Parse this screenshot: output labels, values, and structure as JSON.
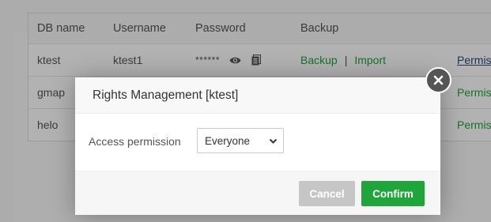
{
  "table": {
    "headers": {
      "db_name": "DB name",
      "username": "Username",
      "password": "Password",
      "backup": "Backup"
    },
    "rows": [
      {
        "db_name": "ktest",
        "username": "ktest1",
        "password": "******",
        "backup": "Backup",
        "import": "Import",
        "permission": "Permis"
      },
      {
        "db_name": "gmap",
        "permission": "Permis"
      },
      {
        "db_name": "helo",
        "permission": "Permis"
      }
    ],
    "separator": "|"
  },
  "dialog": {
    "title": "Rights Management [ktest]",
    "access_label": "Access permission",
    "access_value": "Everyone",
    "cancel_label": "Cancel",
    "confirm_label": "Confirm"
  },
  "colors": {
    "accent": "#20a53a",
    "cancel": "#c6c6c6",
    "close": "#555555"
  },
  "icons": [
    "eye-icon",
    "copy-icon",
    "close-icon",
    "chevron-down-icon"
  ]
}
